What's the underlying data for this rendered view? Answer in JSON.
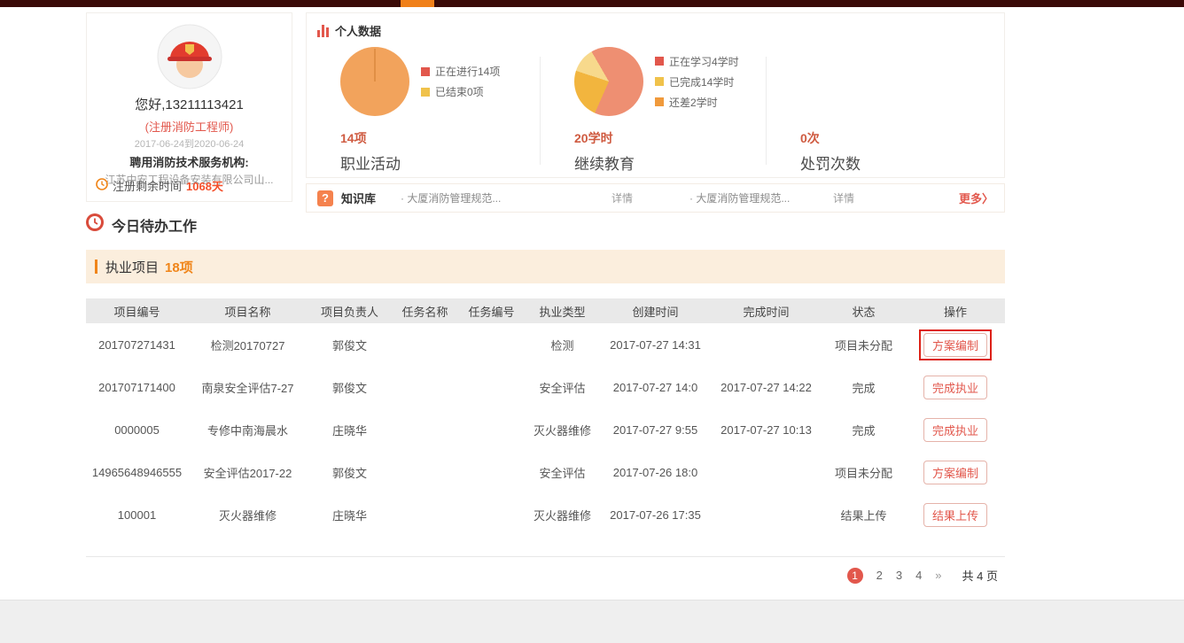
{
  "topbar": {
    "bar_color": "#3a0a07",
    "accent_color": "#f0801a"
  },
  "profile": {
    "greeting": "您好,13211113421",
    "title": "(注册消防工程师)",
    "date_range": "2017-06-24到2020-06-24",
    "employer_label": "聘用消防技术服务机构:",
    "employer": "江苏中安工程设备安装有限公司山...",
    "remaining_label": "注册剩余时间",
    "remaining_value": "1068天"
  },
  "personal_data": {
    "title": "个人数据",
    "sections": [
      {
        "count": "14项",
        "label": "职业活动",
        "legend": [
          {
            "label": "正在进行14项",
            "color": "#e2574c"
          },
          {
            "label": "已结束0项",
            "color": "#f0c24b"
          }
        ]
      },
      {
        "count": "20学时",
        "label": "继续教育",
        "legend": [
          {
            "label": "正在学习4学时",
            "color": "#e2574c"
          },
          {
            "label": "已完成14学时",
            "color": "#f0c24b"
          },
          {
            "label": "还差2学时",
            "color": "#f09a3c"
          }
        ]
      },
      {
        "count": "0次",
        "label": "处罚次数",
        "legend": []
      }
    ]
  },
  "knowledge": {
    "icon": "?",
    "title": "知识库",
    "items": [
      {
        "text": "· 大厦消防管理规范...",
        "detail": "详情"
      },
      {
        "text": "· 大厦消防管理规范...",
        "detail": "详情"
      }
    ],
    "more": "更多〉"
  },
  "todo": {
    "title": "今日待办工作"
  },
  "projects": {
    "title": "执业项目",
    "count": "18项",
    "columns": [
      "项目编号",
      "项目名称",
      "项目负责人",
      "任务名称",
      "任务编号",
      "执业类型",
      "创建时间",
      "完成时间",
      "状态",
      "操作"
    ],
    "rows": [
      {
        "id": "201707271431",
        "name": "检测20170727",
        "leader": "郭俊文",
        "task_name": "",
        "task_no": "",
        "type": "检测",
        "created": "2017-07-27 14:31",
        "finished": "",
        "status": "项目未分配",
        "action": "方案编制"
      },
      {
        "id": "201707171400",
        "name": "南泉安全评估7-27",
        "leader": "郭俊文",
        "task_name": "",
        "task_no": "",
        "type": "安全评估",
        "created": "2017-07-27 14:0",
        "finished": "2017-07-27 14:22",
        "status": "完成",
        "action": "完成执业"
      },
      {
        "id": "0000005",
        "name": "专修中南海晨水",
        "leader": "庄晓华",
        "task_name": "",
        "task_no": "",
        "type": "灭火器维修",
        "created": "2017-07-27 9:55",
        "finished": "2017-07-27 10:13",
        "status": "完成",
        "action": "完成执业"
      },
      {
        "id": "14965648946555",
        "name": "安全评估2017-22",
        "leader": "郭俊文",
        "task_name": "",
        "task_no": "",
        "type": "安全评估",
        "created": "2017-07-26 18:0",
        "finished": "",
        "status": "项目未分配",
        "action": "方案编制"
      },
      {
        "id": "100001",
        "name": "灭火器维修",
        "leader": "庄晓华",
        "task_name": "",
        "task_no": "",
        "type": "灭火器维修",
        "created": "2017-07-26 17:35",
        "finished": "",
        "status": "结果上传",
        "action": "结果上传"
      }
    ],
    "pagination": {
      "current": "1",
      "pages": [
        "2",
        "3",
        "4"
      ],
      "next": "»",
      "total": "共 4 页"
    }
  }
}
